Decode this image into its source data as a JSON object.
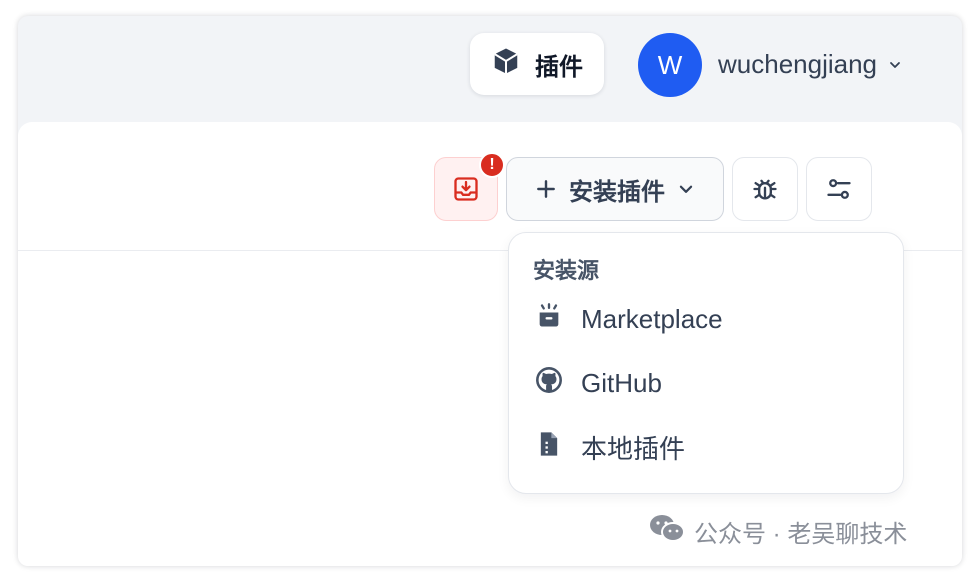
{
  "header": {
    "plugins_label": "插件",
    "plugins_icon": "cube-icon",
    "avatar_letter": "W",
    "avatar_color": "#1f5cf2",
    "username": "wuchengjiang"
  },
  "toolbar": {
    "notification_badge": "!",
    "install_label": "安装插件",
    "download_icon": "tray-download-icon",
    "debug_icon": "bug-icon",
    "settings_icon": "sliders-icon"
  },
  "dropdown": {
    "title": "安装源",
    "items": [
      {
        "label": "Marketplace",
        "icon": "marketplace-icon"
      },
      {
        "label": "GitHub",
        "icon": "github-icon"
      },
      {
        "label": "本地插件",
        "icon": "local-file-icon"
      }
    ]
  },
  "watermark": {
    "text": "公众号 · 老吴聊技术",
    "icon": "wechat-icon"
  },
  "colors": {
    "accent": "#1f5cf2",
    "danger": "#d92d20",
    "background": "#f2f4f7"
  }
}
